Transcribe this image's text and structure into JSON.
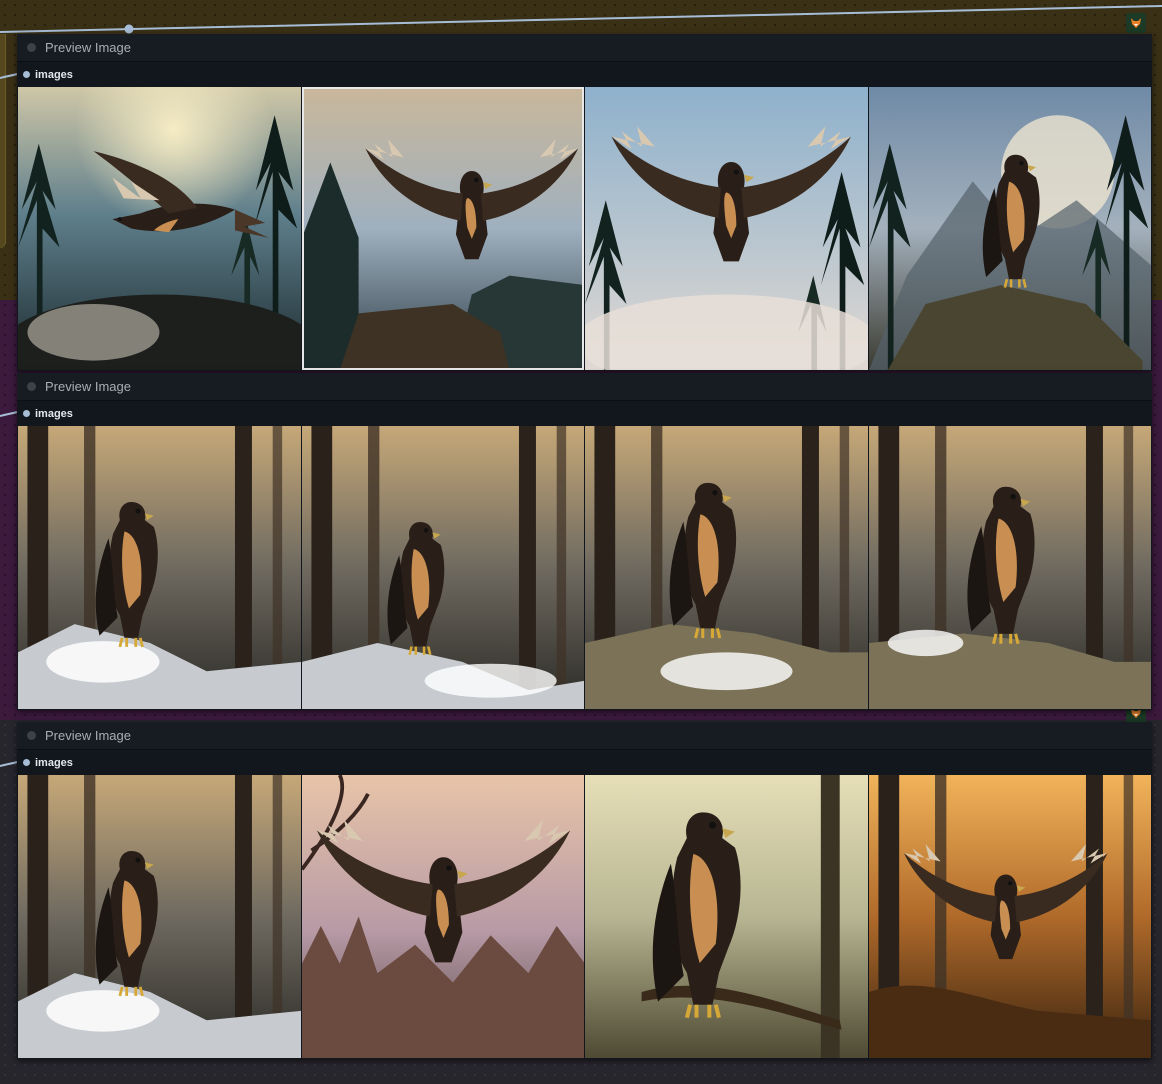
{
  "nodes": [
    {
      "title": "Preview Image",
      "output_label": "images",
      "images": [
        {
          "icon": "hawk-flying-left-icon",
          "scene": "misty-sky"
        },
        {
          "icon": "hawk-perched-wings-open-icon",
          "scene": "cloud-sky",
          "selected": true
        },
        {
          "icon": "hawk-wings-spread-icon",
          "scene": "foggy-valley"
        },
        {
          "icon": "hawk-perched-moon-icon",
          "scene": "moon-mountain"
        }
      ]
    },
    {
      "title": "Preview Image",
      "output_label": "images",
      "images": [
        {
          "icon": "hawk-perched-snow-icon",
          "scene": "snowy-forest"
        },
        {
          "icon": "hawk-perched-snow-icon",
          "scene": "snowy-forest"
        },
        {
          "icon": "hawk-perched-snow-icon",
          "scene": "snowy-forest"
        },
        {
          "icon": "hawk-perched-snow-icon",
          "scene": "snowy-forest"
        }
      ]
    },
    {
      "title": "Preview Image",
      "output_label": "images",
      "images": [
        {
          "icon": "hawk-perched-snow-icon",
          "scene": "snowy-forest"
        },
        {
          "icon": "hawk-wings-spread-icon",
          "scene": "sunset-forest"
        },
        {
          "icon": "hawk-perched-branch-icon",
          "scene": "sunlit-forest"
        },
        {
          "icon": "hawk-flying-icon",
          "scene": "golden-forest"
        }
      ]
    }
  ],
  "colors": {
    "node_body": "#12161d",
    "node_header": "#171b22",
    "group_brown": "#3a3015",
    "group_purple": "#3c1a3e",
    "wire": "#a7bdd6"
  }
}
